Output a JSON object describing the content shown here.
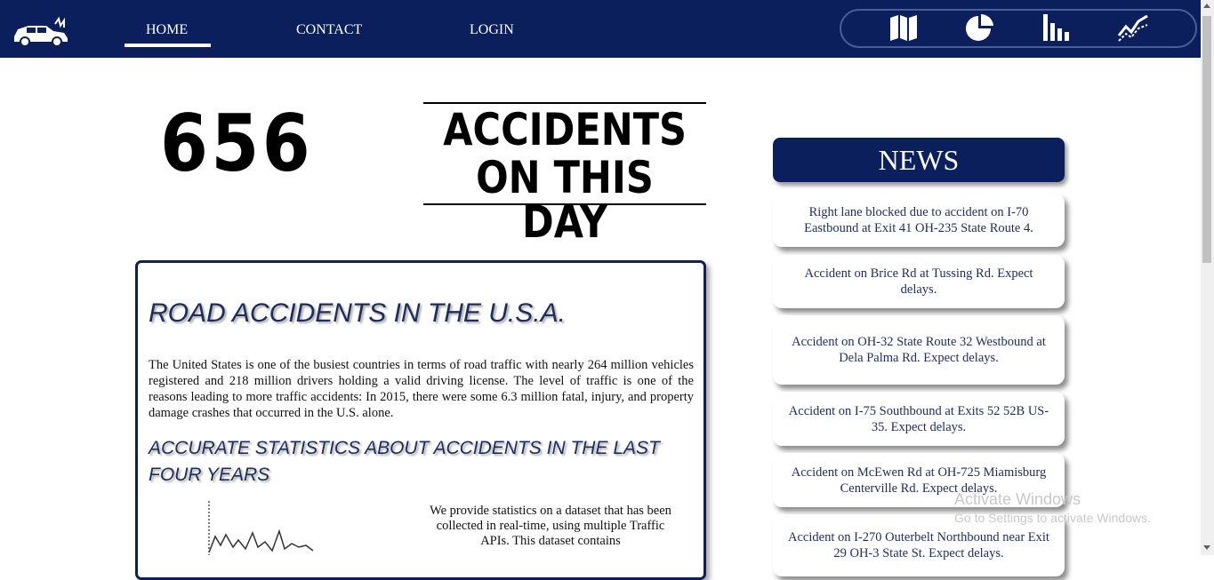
{
  "nav": {
    "links": [
      "HOME",
      "CONTACT",
      "LOGIN"
    ],
    "active": "HOME",
    "icons": [
      "map-icon",
      "pie-chart-icon",
      "bar-chart-icon",
      "line-chart-icon"
    ],
    "colors": {
      "navbar": "#0a1f5c",
      "text": "#ffffff"
    }
  },
  "counter": {
    "value": "656",
    "label_line1": "ACCIDENTS",
    "label_line2": "ON THIS DAY"
  },
  "article": {
    "title": "ROAD ACCIDENTS IN THE U.S.A.",
    "body": "The United States is one of the busiest countries in terms of road traffic with nearly 264 million vehicles registered and 218 million drivers holding a valid driving license. The level of traffic is one of the reasons leading to more traffic accidents: In 2015, there were some 6.3 million fatal, injury, and property damage crashes that occurred in the U.S. alone.",
    "subtitle": "ACCURATE STATISTICS ABOUT ACCIDENTS IN THE LAST FOUR YEARS",
    "dataset_text": "We provide statistics on a dataset that has been collected in real-time, using multiple Traffic APIs. This dataset contains"
  },
  "news": {
    "header": "NEWS",
    "items": [
      "Right lane blocked due to accident on I-70 Eastbound at Exit 41 OH-235 State Route 4.",
      "Accident on Brice Rd at Tussing Rd. Expect delays.",
      "Accident on OH-32 State Route 32 Westbound at Dela Palma Rd. Expect delays.",
      "Accident on I-75 Southbound at Exits 52 52B US-35. Expect delays.",
      "Accident on McEwen Rd at OH-725 Miamisburg Centerville Rd. Expect delays.",
      "Accident on I-270 Outerbelt Northbound near Exit 29 OH-3 State St. Expect delays."
    ]
  },
  "watermark": {
    "line1": "Activate Windows",
    "line2": "Go to Settings to activate Windows."
  }
}
